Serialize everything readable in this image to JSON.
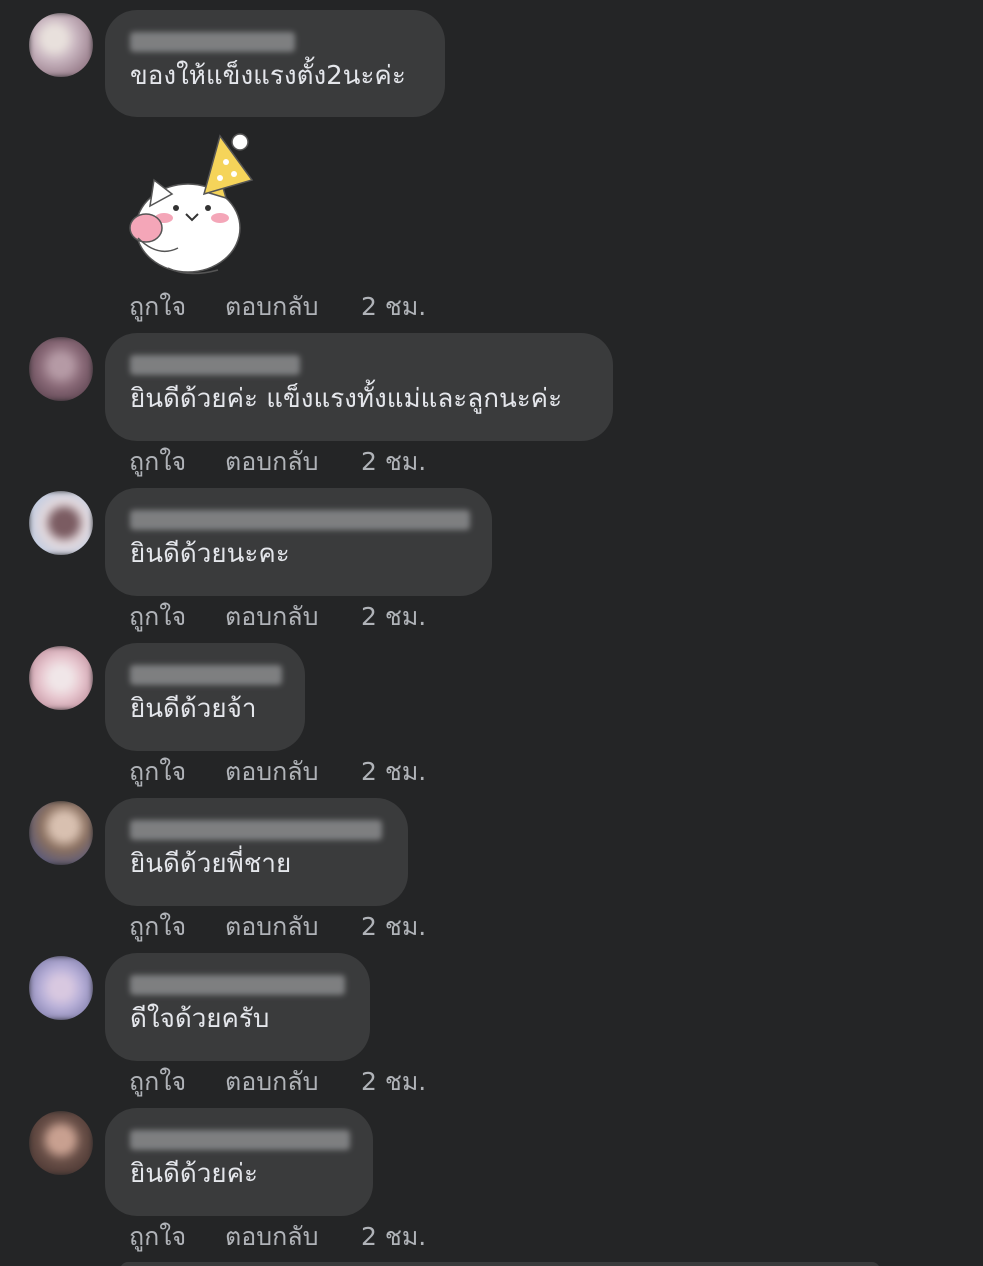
{
  "comments": [
    {
      "text": "ของให้แข็งแรงตั้ง2นะค่ะ",
      "like": "ถูกใจ",
      "reply": "ตอบกลับ",
      "time": "2 ชม.",
      "has_sticker": true,
      "avatar_colors": [
        "#c9b6c0",
        "#7a5a6a",
        "#e8e0dc"
      ]
    },
    {
      "text": "ยินดีด้วยค่ะ แข็งแรงทั้งแม่และลูกนะค่ะ",
      "like": "ถูกใจ",
      "reply": "ตอบกลับ",
      "time": "2 ชม.",
      "avatar_colors": [
        "#8a6a78",
        "#4a3440",
        "#b59aa5"
      ]
    },
    {
      "text": "ยินดีด้วยนะคะ",
      "like": "ถูกใจ",
      "reply": "ตอบกลับ",
      "time": "2 ชม.",
      "avatar_colors": [
        "#a9c4e6",
        "#7b5c62",
        "#e2d8dc"
      ]
    },
    {
      "text": "ยินดีด้วยจ้า",
      "like": "ถูกใจ",
      "reply": "ตอบกลับ",
      "time": "2 ชม.",
      "avatar_colors": [
        "#e8c8d0",
        "#b07a8a",
        "#f0e6e8"
      ]
    },
    {
      "text": "ยินดีด้วยพี่ชาย",
      "like": "ถูกใจ",
      "reply": "ตอบกลับ",
      "time": "2 ชม.",
      "avatar_colors": [
        "#8a7060",
        "#3a4a8a",
        "#d8c0b0"
      ]
    },
    {
      "text": "ดีใจด้วยครับ",
      "like": "ถูกใจ",
      "reply": "ตอบกลับ",
      "time": "2 ชม.",
      "avatar_colors": [
        "#b8b0d8",
        "#6a6a9a",
        "#d8c8e0"
      ]
    },
    {
      "text": "ยินดีด้วยค่ะ",
      "like": "ถูกใจ",
      "reply": "ตอบกลับ",
      "time": "2 ชม.",
      "avatar_colors": [
        "#6a5048",
        "#3a2a28",
        "#c8a090"
      ]
    }
  ],
  "sticker": {
    "name": "party-cat-sticker",
    "hat_color": "#f5d45a",
    "cheek_color": "#f4a6b8"
  },
  "theme": {
    "background": "#242526",
    "bubble": "#3a3b3c",
    "text": "#e4e6eb",
    "muted": "#b0b3b8"
  }
}
